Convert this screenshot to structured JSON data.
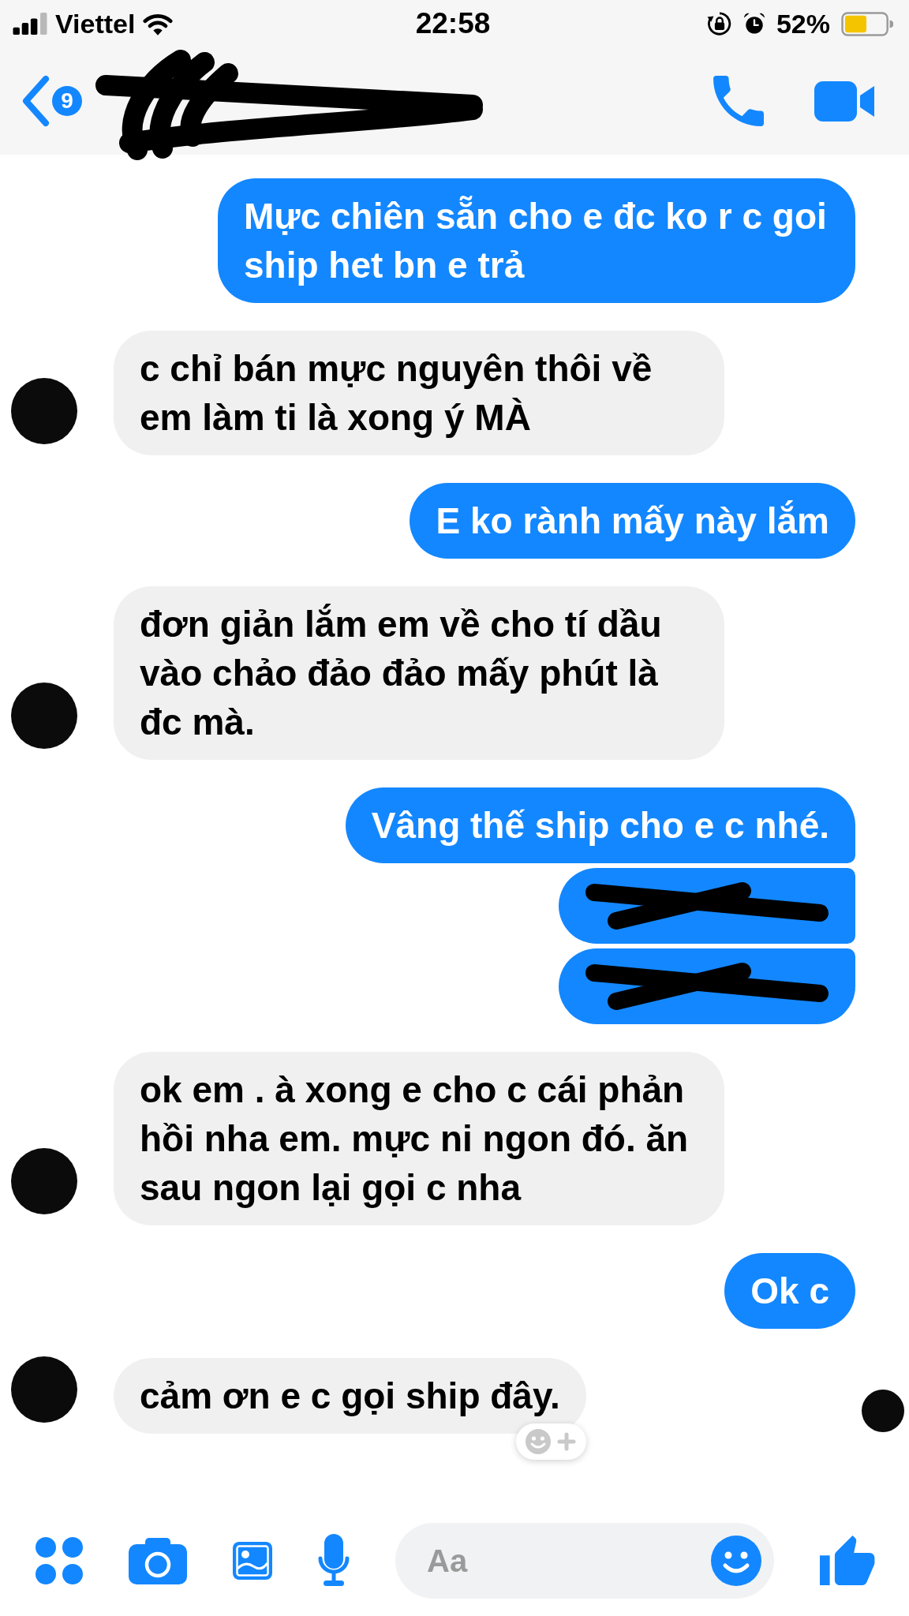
{
  "status_bar": {
    "carrier": "Viettel",
    "time": "22:58",
    "battery": "52%"
  },
  "header": {
    "back_badge": "9"
  },
  "messages": [
    {
      "kind": "text",
      "outgoing": true,
      "text": "Mực chiên sẵn cho e đc ko r c goi ship het bn e trả",
      "seen": false,
      "reaction_button": false
    },
    {
      "kind": "text",
      "outgoing": false,
      "text": "c chỉ bán mực nguyên thôi về em làm ti là xong ý MÀ",
      "seen": false,
      "reaction_button": false
    },
    {
      "kind": "text",
      "outgoing": true,
      "text": "E ko rành mấy này lắm",
      "seen": false,
      "reaction_button": false
    },
    {
      "kind": "text",
      "outgoing": false,
      "text": "đơn giản lắm em về cho tí dầu vào chảo đảo đảo mấy phút là đc mà.",
      "seen": false,
      "reaction_button": false
    },
    {
      "kind": "text",
      "outgoing": true,
      "text": "Vâng thế ship cho e c nhé.",
      "seen": false,
      "reaction_button": false
    },
    {
      "kind": "redacted",
      "outgoing": true,
      "seen": false,
      "reaction_button": false
    },
    {
      "kind": "redacted",
      "outgoing": true,
      "seen": false,
      "reaction_button": false
    },
    {
      "kind": "text",
      "outgoing": false,
      "text": "ok em . à xong e cho c cái phản hồi nha em. mực ni ngon đó. ăn sau ngon lại gọi c nha",
      "seen": false,
      "reaction_button": false
    },
    {
      "kind": "text",
      "outgoing": true,
      "text": "Ok c",
      "seen": false,
      "reaction_button": false
    },
    {
      "kind": "text",
      "outgoing": false,
      "text": "cảm ơn e c gọi ship đây.",
      "seen": true,
      "reaction_button": true
    }
  ],
  "composer": {
    "placeholder": "Aa"
  }
}
